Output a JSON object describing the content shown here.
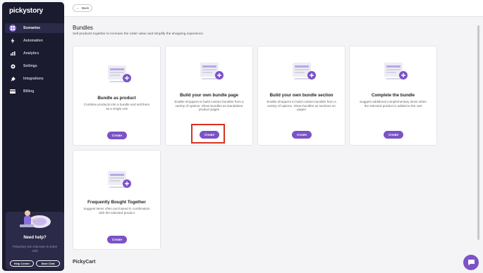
{
  "sidebar": {
    "logo": "pickystory",
    "items": [
      {
        "label": "Scenarios",
        "icon": "grid-icon",
        "active": true
      },
      {
        "label": "Automation",
        "icon": "lightning-icon"
      },
      {
        "label": "Analytics",
        "icon": "bar-chart-icon"
      },
      {
        "label": "Settings",
        "icon": "gear-icon"
      },
      {
        "label": "Integrations",
        "icon": "plug-icon"
      },
      {
        "label": "Billing",
        "icon": "credit-card-icon"
      }
    ],
    "help": {
      "title": "Need help?",
      "description": "PickyStory live chat team is online 24/6",
      "help_center": "Help Center",
      "start_chat": "Start Chat"
    }
  },
  "topbar": {
    "back_label": "Back"
  },
  "main": {
    "title": "Bundles",
    "description": "Sell products together to increase the order value and simplify the shopping experience",
    "cards": [
      {
        "title": "Bundle as product",
        "description": "Combine products into a bundle and sell them as a single unit",
        "button": "Create"
      },
      {
        "title": "Build your own bundle page",
        "description": "Enable shoppers to build custom bundles from a variety of options. Show bundles as standalone product pages",
        "button": "Create"
      },
      {
        "title": "Build your own bundle section",
        "description": "Enable shoppers to build custom bundles from a variety of options. Show bundles as sections on pages",
        "button": "Create"
      },
      {
        "title": "Complete the bundle",
        "description": "Suggest additional complementary items when the selected product is added to the cart",
        "button": "Create"
      },
      {
        "title": "Frequently Bought Together",
        "description": "Suggest items often purchased in combination with the selected product",
        "button": "Create"
      }
    ],
    "next_section": "PickyCart"
  },
  "colors": {
    "accent": "#7b53c6",
    "sidebar_bg": "#1a1b2e",
    "highlight": "#d9301f"
  }
}
